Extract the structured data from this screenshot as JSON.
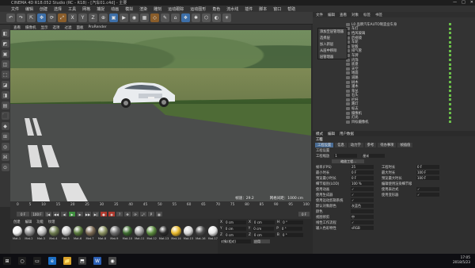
{
  "window": {
    "title": "CINEMA 4D R18.052 Studio (RC - R18) - [汽车01.c4d] - 主要"
  },
  "window_buttons": [
    "—",
    "□",
    "✕"
  ],
  "menu": [
    "文件",
    "编辑",
    "创建",
    "选择",
    "工具",
    "网格",
    "捕捉",
    "动画",
    "模拟",
    "渲染",
    "雕刻",
    "运动跟踪",
    "运动图形",
    "角色",
    "流水线",
    "插件",
    "脚本",
    "窗口",
    "帮助"
  ],
  "toolbar_icons": [
    "↶",
    "↷",
    "⇱",
    "✥",
    "⟳",
    "⤢",
    "X",
    "Y",
    "Z",
    "⊕",
    "▣",
    "▶",
    "◉",
    "▦",
    "◇",
    "✎",
    "⌂",
    "❖",
    "✱",
    "⬡",
    "◐",
    "☀"
  ],
  "viewport": {
    "menu": [
      "查看",
      "摄像机",
      "显示",
      "选项",
      "过滤",
      "面板",
      "ProRender"
    ],
    "status_left": "帧速：29.2",
    "status_right": "网格间距：1000 cm"
  },
  "side_tools": [
    "◧",
    "◩",
    "▣",
    "◫",
    "⬚",
    "◪",
    "◨",
    "▤",
    "⬛",
    "◆",
    "⊞",
    "◎",
    "⌘",
    "⊙"
  ],
  "object_panel": {
    "tabs": [
      "文件",
      "编辑",
      "查看",
      "对象",
      "标签",
      "书签"
    ],
    "context_menu": [
      "添加至层管理器",
      "选择层",
      "加入新层",
      "从层中移除",
      "层管理器"
    ],
    "objects": [
      "L0 品牌汽车AUTO制造业车身",
      "车灯",
      "挡风玻璃",
      "后视镜",
      "车轮",
      "轮毂",
      "排气管",
      "车牌",
      "内饰",
      "底盘",
      "天空",
      "地面",
      "道路",
      "树木",
      "灌木",
      "草丛",
      "石头",
      "栏杆",
      "路灯",
      "标志",
      "摄像机",
      "灯光",
      "目标摄像机"
    ]
  },
  "attributes": {
    "menu": [
      "模式",
      "编辑",
      "用户数据"
    ],
    "section": "工程",
    "tabs": [
      "工程设置",
      "信息",
      "动力学",
      "参考",
      "待办事项",
      "帧插值"
    ],
    "subtitle": "工程设置",
    "scale_label": "工程缩放",
    "scale_value": "1",
    "scale_unit": "厘米",
    "scale_button": "缩放工程...",
    "rows": [
      {
        "l": "帧率(FPS)",
        "v": "25",
        "l2": "工程时长",
        "v2": "0 F"
      },
      {
        "l": "最小时长",
        "v": "0 F",
        "l2": "最大时长",
        "v2": "100 F"
      },
      {
        "l": "预览最小时长",
        "v": "0 F",
        "l2": "预览最大时长",
        "v2": "100 F"
      },
      {
        "l": "细节级别(LOD)",
        "v": "100 %",
        "l2": "编辑使用渲染细节级别(LOD)级别",
        "v2": ""
      },
      {
        "l": "使用动画",
        "v": "✓",
        "l2": "使用表达式",
        "v2": "✓"
      },
      {
        "l": "使用生成器",
        "v": "✓",
        "l2": "使用变形器",
        "v2": "✓"
      },
      {
        "l": "使用运动剪辑系统",
        "v": "✓",
        "l2": "",
        "v2": ""
      },
      {
        "l": "默认对象颜色",
        "v": "灰蓝色",
        "l2": "",
        "v2": ""
      },
      {
        "l": "颜色",
        "v": "",
        "l2": "",
        "v2": ""
      },
      {
        "l": "视图修剪",
        "v": "中",
        "l2": "",
        "v2": ""
      },
      {
        "l": "线性工作流程",
        "v": "✓",
        "l2": "",
        "v2": ""
      },
      {
        "l": "输入色彩特性",
        "v": "sRGB",
        "l2": "",
        "v2": ""
      }
    ]
  },
  "timeline": {
    "ticks": [
      "0",
      "5",
      "10",
      "15",
      "20",
      "25",
      "30",
      "35",
      "40",
      "45",
      "50",
      "55",
      "60",
      "65",
      "70",
      "75",
      "80",
      "85",
      "90",
      "95",
      "100"
    ],
    "frame_start": "0 F",
    "frame_end": "100 F",
    "current": "0 F"
  },
  "materials": {
    "menu": [
      "创建",
      "编辑",
      "功能",
      "纹理"
    ],
    "swatches": [
      {
        "name": "Mat.1",
        "color": "#f2f2f2"
      },
      {
        "name": "Mat.2",
        "color": "#8e8e8e"
      },
      {
        "name": "Mat.3",
        "color": "#bfbfbf"
      },
      {
        "name": "Mat.4",
        "color": "#6c7a4e"
      },
      {
        "name": "Mat.5",
        "color": "#c9c9c9"
      },
      {
        "name": "Mat.6",
        "color": "#58783a"
      },
      {
        "name": "Mat.7",
        "color": "#7c6b55"
      },
      {
        "name": "Mat.8",
        "color": "#8a9161"
      },
      {
        "name": "Mat.9",
        "color": "#6b6b6b"
      },
      {
        "name": "Mat.10",
        "color": "#3d6c2f"
      },
      {
        "name": "Mat.11",
        "color": "#9e9e9e"
      },
      {
        "name": "Mat.12",
        "color": "#5a8a3c"
      },
      {
        "name": "Mat.13",
        "color": "#2c2c2c"
      },
      {
        "name": "Mat.14",
        "color": "#e8b82a"
      },
      {
        "name": "Mat.15",
        "color": "#d7d7d7"
      },
      {
        "name": "Mat.16",
        "color": "#4c4c4c"
      },
      {
        "name": "Mat.17",
        "color": "#e5e5e5"
      }
    ]
  },
  "coords": {
    "rows": [
      {
        "a": "X",
        "v1": "0 cm",
        "b": "X",
        "v2": "0 cm",
        "c": "H",
        "v3": "0 °"
      },
      {
        "a": "Y",
        "v1": "0 cm",
        "b": "Y",
        "v2": "0 cm",
        "c": "P",
        "v3": "0 °"
      },
      {
        "a": "Z",
        "v1": "0 cm",
        "b": "Z",
        "v2": "0 cm",
        "c": "B",
        "v3": "0 °"
      }
    ],
    "mode": "对象(相对)",
    "apply": "应用"
  },
  "taskbar": {
    "icons": [
      "⊞",
      "○",
      "▭",
      "e",
      "📁",
      "⬒",
      "W",
      "◉"
    ],
    "time": "17:05",
    "date": "2018/5/23"
  }
}
